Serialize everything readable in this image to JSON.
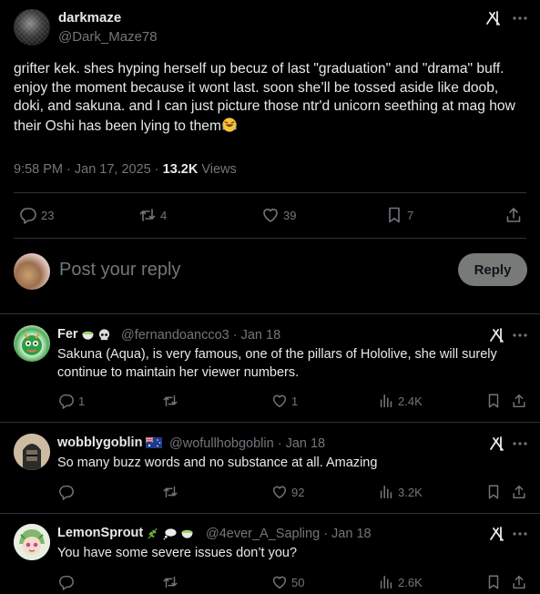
{
  "main_post": {
    "display_name": "darkmaze",
    "handle": "@Dark_Maze78",
    "text": "grifter kek. shes hyping herself up becuz of last \"graduation\" and \"drama\" buff. enjoy the moment because it wont last. soon she’ll be tossed aside like doob, doki, and sakuna. and I can just picture those ntr'd unicorn seething at mag how their Oshi has been lying to them",
    "timestamp": "9:58 PM · Jan 17, 2025 · ",
    "views_count": "13.2K",
    "views_label": " Views",
    "actions": {
      "replies": "23",
      "reposts": "4",
      "likes": "39",
      "bookmarks": "7"
    }
  },
  "composer": {
    "placeholder": "Post your reply",
    "button_label": "Reply"
  },
  "replies": [
    {
      "display_name": "Fer",
      "handle_meta": "@fernandoancco3 · Jan 18",
      "text": "Sakuna (Aqua), is very famous, one of the pillars of Hololive, she will surely continue to maintain her viewer numbers.",
      "replies": "1",
      "reposts": "",
      "likes": "1",
      "views": "2.4K"
    },
    {
      "display_name": "wobblygoblin",
      "handle_meta": "@wofullhobgoblin · Jan 18",
      "text": "So many buzz words and no substance at all. Amazing",
      "replies": "",
      "reposts": "",
      "likes": "92",
      "views": "3.2K"
    },
    {
      "display_name": "LemonSprout",
      "handle_meta": "@4ever_A_Sapling · Jan 18",
      "text": "You have some severe issues don’t you?",
      "replies": "",
      "reposts": "",
      "likes": "50",
      "views": "2.6K"
    }
  ],
  "icons": {
    "grok": "grok-icon",
    "more": "more-icon",
    "reply": "reply-icon",
    "repost": "repost-icon",
    "like": "like-icon",
    "views": "views-icon",
    "bookmark": "bookmark-icon",
    "share": "share-icon"
  },
  "colors": {
    "background": "#000000",
    "text": "#e7e9ea",
    "muted": "#71767b",
    "divider": "#2f3336",
    "reply_button": "#787a7a"
  }
}
